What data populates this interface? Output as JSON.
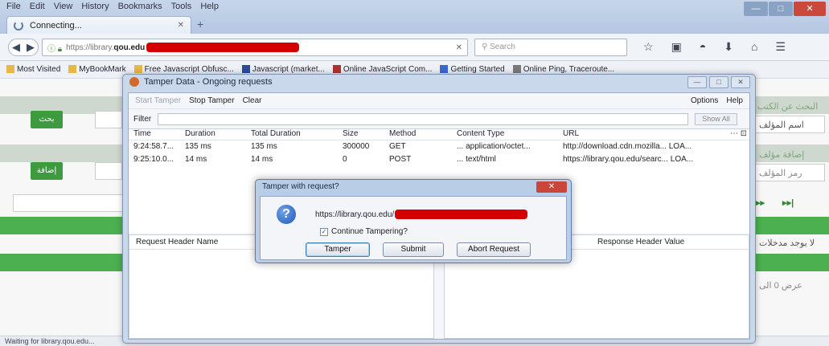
{
  "browser": {
    "menu": [
      "File",
      "Edit",
      "View",
      "History",
      "Bookmarks",
      "Tools",
      "Help"
    ],
    "window_buttons": [
      "—",
      "□",
      "✕"
    ],
    "tab": {
      "title": "Connecting...",
      "close": "✕"
    },
    "new_tab": "+",
    "url": {
      "prefix": "https://library.",
      "domain": "qou.edu",
      "clear": "✕"
    },
    "search_placeholder": "Search",
    "bookmarks": [
      "Most Visited",
      "MyBookMark",
      "Free Javascript Obfusc...",
      "Javascript (market...",
      "Online JavaScript Com...",
      "Getting Started",
      "Online Ping, Traceroute..."
    ],
    "status": "Waiting for library.qou.edu..."
  },
  "page": {
    "search_button": "بحث",
    "add_button": "إضافة",
    "search_heading": "البحث عن الكتب",
    "author_name_label": "اسم المؤلف",
    "add_author_heading": "إضافة مؤلف",
    "author_code_label": "رمز المؤلف",
    "no_entries": "لا يوجد مدخلات",
    "showing": "عرض 0 الى",
    "pager_next": "▸▸",
    "pager_last": "▸▸|"
  },
  "tamper": {
    "title": "Tamper Data - Ongoing requests",
    "toolbar": {
      "start": "Start Tamper",
      "stop": "Stop Tamper",
      "clear": "Clear",
      "options": "Options",
      "help": "Help"
    },
    "filter_label": "Filter",
    "show_all": "Show All",
    "columns": {
      "time": "Time",
      "duration": "Duration",
      "total": "Total Duration",
      "size": "Size",
      "method": "Method",
      "content_type": "Content Type",
      "url": "URL",
      "menu": "⋯ ⊡"
    },
    "rows": [
      {
        "time": "9:24:58.7...",
        "duration": "135 ms",
        "total": "135 ms",
        "size": "300000",
        "method": "GET",
        "content_type": "... application/octet...",
        "url": "http://download.cdn.mozilla... LOA..."
      },
      {
        "time": "9:25:10.0...",
        "duration": "14 ms",
        "total": "14 ms",
        "size": "0",
        "method": "POST",
        "content_type": "... text/html",
        "url": "https://library.qou.edu/searc... LOA..."
      }
    ],
    "request_header_name": "Request Header Name",
    "response_header_value": "Response Header Value"
  },
  "dialog": {
    "title": "Tamper with request?",
    "close": "✕",
    "url_prefix": "https://library.qou.edu/",
    "continue_label": "Continue Tampering?",
    "continue_checked": "✓",
    "buttons": {
      "tamper": "Tamper",
      "submit": "Submit",
      "abort": "Abort Request"
    }
  }
}
